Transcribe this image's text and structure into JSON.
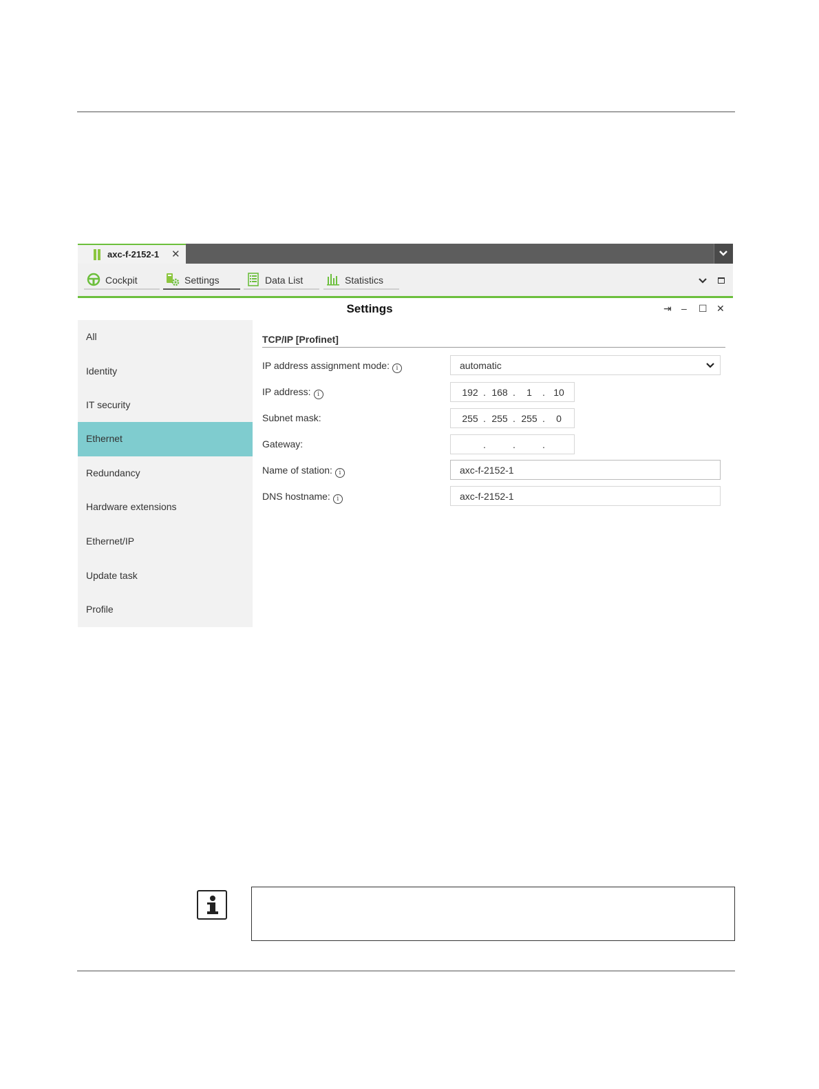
{
  "document_tab": {
    "title": "axc-f-2152-1",
    "close_glyph": "✕"
  },
  "view_tabs": [
    {
      "label": "Cockpit",
      "icon": "steering-wheel-icon",
      "active": false
    },
    {
      "label": "Settings",
      "icon": "settings-gear-icon",
      "active": true
    },
    {
      "label": "Data List",
      "icon": "list-icon",
      "active": false
    },
    {
      "label": "Statistics",
      "icon": "bar-chart-icon",
      "active": false
    }
  ],
  "panel": {
    "title": "Settings",
    "controls": {
      "pin": "⇥",
      "minimize": "–",
      "maximize": "☐",
      "close": "✕"
    }
  },
  "sidebar": {
    "items": [
      {
        "label": "All"
      },
      {
        "label": "Identity"
      },
      {
        "label": "IT security"
      },
      {
        "label": "Ethernet",
        "active": true
      },
      {
        "label": "Redundancy"
      },
      {
        "label": "Hardware extensions"
      },
      {
        "label": "Ethernet/IP"
      },
      {
        "label": "Update task"
      },
      {
        "label": "Profile"
      }
    ]
  },
  "content": {
    "section_title": "TCP/IP [Profinet]",
    "fields": {
      "assignment_mode": {
        "label": "IP address assignment mode:",
        "value": "automatic"
      },
      "ip_address": {
        "label": "IP address:",
        "octets": [
          "192",
          "168",
          "1",
          "10"
        ]
      },
      "subnet_mask": {
        "label": "Subnet mask:",
        "octets": [
          "255",
          "255",
          "255",
          "0"
        ]
      },
      "gateway": {
        "label": "Gateway:",
        "octets": [
          "",
          "",
          "",
          ""
        ]
      },
      "station_name": {
        "label": "Name of station:",
        "value": "axc-f-2152-1"
      },
      "dns_hostname": {
        "label": "DNS hostname:",
        "value": "axc-f-2152-1"
      }
    },
    "info_glyph": "i",
    "ip_separator": "."
  },
  "colors": {
    "accent_green": "#6cbf3c",
    "sidebar_active": "#7fcccf",
    "topbar": "#5d5d5d"
  }
}
